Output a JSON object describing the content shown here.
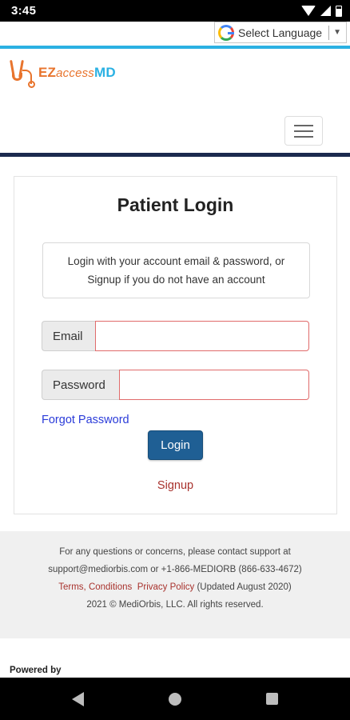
{
  "status_bar": {
    "time": "3:45"
  },
  "translate": {
    "label": "Select Language",
    "arrow": "▼"
  },
  "header": {
    "brand_ez": "EZ",
    "brand_access": "access",
    "brand_md": "MD"
  },
  "login": {
    "title": "Patient Login",
    "info_line1": "Login with your account email & password, or",
    "info_line2": "Signup if you do not have an account",
    "email_label": "Email",
    "email_value": "",
    "password_label": "Password",
    "password_value": "",
    "forgot_label": "Forgot Password",
    "login_label": "Login",
    "signup_label": "Signup"
  },
  "footer": {
    "line1": "For any questions or concerns, please contact support at",
    "line2": "support@mediorbis.com or +1-866-MEDIORB (866-633-4672)",
    "terms_label": "Terms, Conditions",
    "privacy_label": "Privacy Policy",
    "updated_text": "(Updated August 2020)",
    "copyright": "2021 © MediOrbis, LLC. All rights reserved.",
    "powered_by": "Powered by"
  },
  "colors": {
    "accent": "#2bb1e3",
    "navy": "#1b2a4e",
    "button": "#1f5f94",
    "link": "#2a3bd9",
    "signup": "#a8322d",
    "logo_orange": "#e8742d"
  }
}
